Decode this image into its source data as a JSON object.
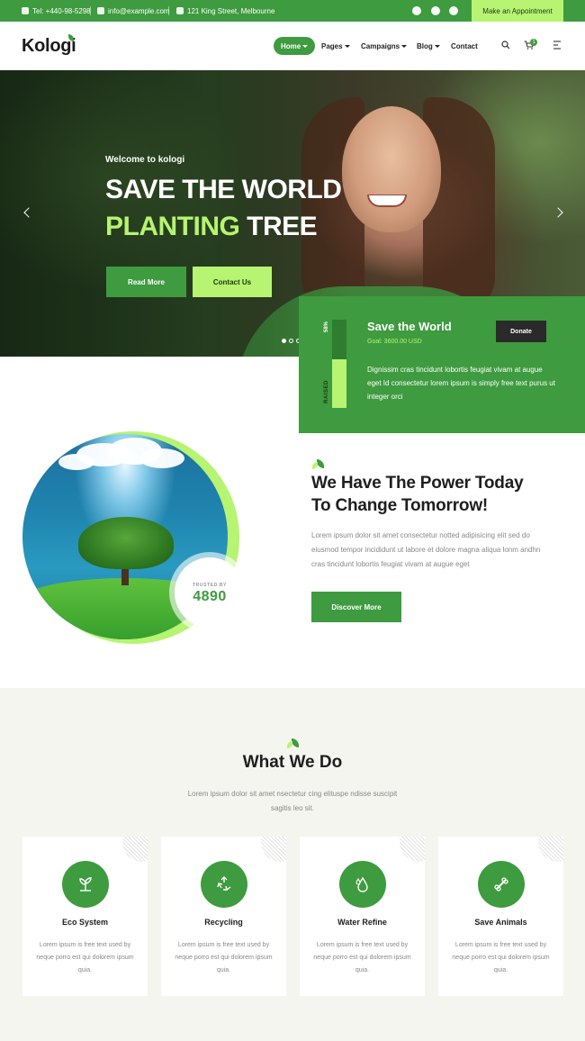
{
  "topbar": {
    "phone": "Tel: +440-98-5298",
    "email": "info@example.com",
    "address": "121 King Street, Melbourne",
    "social": [
      "facebook-icon",
      "twitter-icon",
      "youtube-icon"
    ],
    "appointment_label": "Make an Appointment"
  },
  "header": {
    "logo": "Kologi",
    "nav": [
      {
        "label": "Home",
        "active": true,
        "dropdown": true
      },
      {
        "label": "Pages",
        "dropdown": true
      },
      {
        "label": "Campaigns",
        "dropdown": true
      },
      {
        "label": "Blog",
        "dropdown": true
      },
      {
        "label": "Contact",
        "dropdown": false
      }
    ],
    "cart_count": "1"
  },
  "hero": {
    "welcome": "Welcome to kologi",
    "line1": "SAVE THE WORLD",
    "line2_highlight": "PLANTING",
    "line2_rest": "TREE",
    "read_more": "Read More",
    "contact_us": "Contact Us",
    "slides": 3,
    "active_slide": 1
  },
  "donation": {
    "title": "Save the World",
    "goal": "Goal: 3600.00 USD",
    "donate_label": "Donate",
    "percent_label": "58%",
    "raised_fraction": 0.55,
    "raised_label": "RAISED",
    "text": "Dignissim cras tincidunt lobortis feugiat vivam at augue eget Id consectetur lorem ipsum is simply free text purus ut integer orci"
  },
  "about": {
    "trusted_label": "TRUSTED BY",
    "trusted_number": "4890",
    "heading_line1": "We Have The Power Today",
    "heading_line2": "To Change Tomorrow!",
    "paragraph": "Lorem ipsum dolor sit amet consectetur notted adipisicing elit sed do eiusmod tempor incididunt ut labore et dolore magna aliqua lonm andhn cras tincidunt lobortis feugiat vivam at augue eget",
    "button": "Discover More"
  },
  "services": {
    "title": "What We Do",
    "subtitle": "Lorem ipsum dolor sit amet nsectetur cing elituspe ndisse suscipit sagitis leo sit.",
    "cards": [
      {
        "title": "Eco System",
        "icon": "plant-icon",
        "desc": "Lorem ipsum is free text used by neque porro est qui dolorem ipsum quia."
      },
      {
        "title": "Recycling",
        "icon": "recycle-icon",
        "desc": "Lorem ipsum is free text used by neque porro est qui dolorem ipsum quia."
      },
      {
        "title": "Water Refine",
        "icon": "water-drop-icon",
        "desc": "Lorem ipsum is free text used by neque porro est qui dolorem ipsum quia."
      },
      {
        "title": "Save Animals",
        "icon": "bone-icon",
        "desc": "Lorem ipsum is free text used by neque porro est qui dolorem ipsum quia."
      }
    ]
  },
  "colors": {
    "primary": "#3e9b3f",
    "accent": "#b6f471",
    "dark": "#1e1e1e",
    "light_bg": "#f4f5ef"
  }
}
